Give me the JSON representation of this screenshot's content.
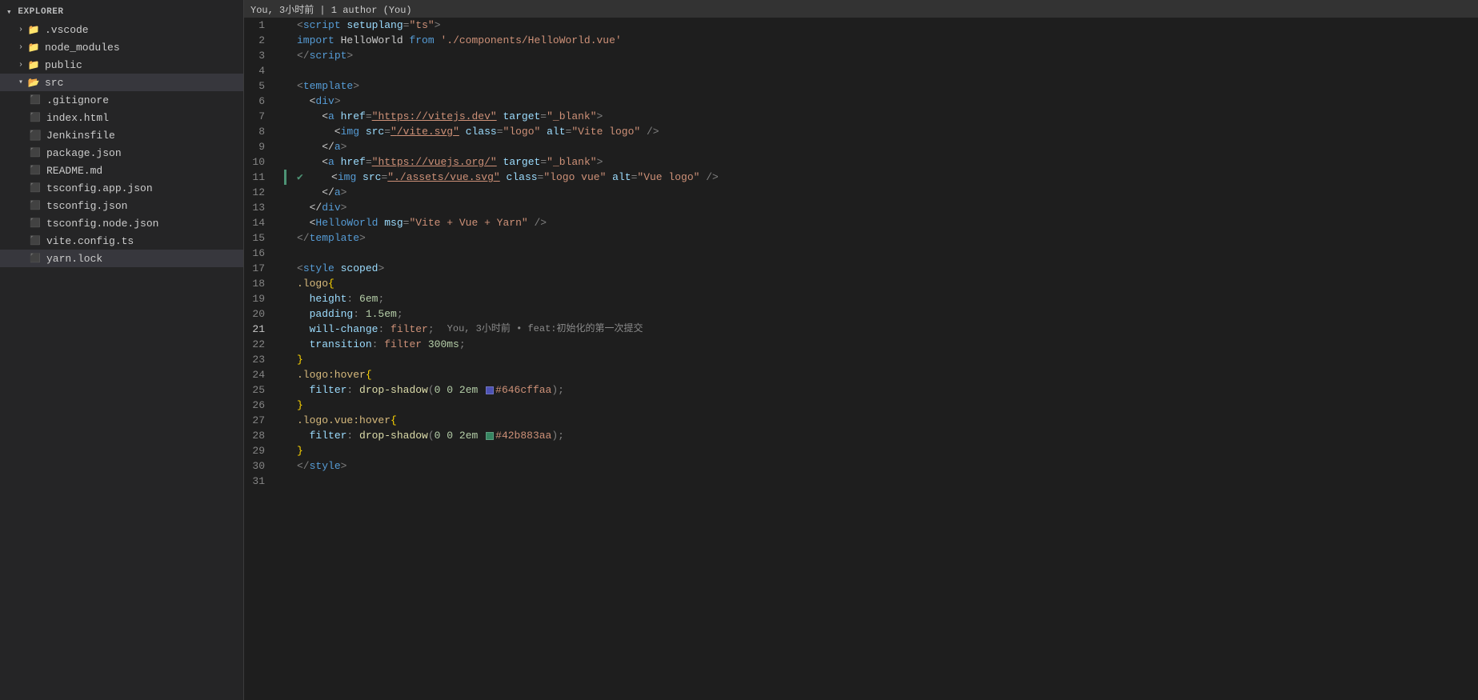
{
  "sidebar": {
    "items": [
      {
        "id": "vscode-folder",
        "label": ".vscode",
        "type": "folder",
        "indent": 1,
        "expanded": false,
        "icon": "folder"
      },
      {
        "id": "node-modules",
        "label": "node_modules",
        "type": "folder",
        "indent": 1,
        "expanded": false,
        "icon": "folder-node"
      },
      {
        "id": "public",
        "label": "public",
        "type": "folder",
        "indent": 1,
        "expanded": false,
        "icon": "folder"
      },
      {
        "id": "src",
        "label": "src",
        "type": "folder",
        "indent": 1,
        "expanded": true,
        "icon": "folder-src"
      },
      {
        "id": "gitignore",
        "label": ".gitignore",
        "type": "file",
        "indent": 2,
        "icon": "git"
      },
      {
        "id": "index-html",
        "label": "index.html",
        "type": "file",
        "indent": 2,
        "icon": "html"
      },
      {
        "id": "jenkinsfile",
        "label": "Jenkinsfile",
        "type": "file",
        "indent": 2,
        "icon": "jenkins"
      },
      {
        "id": "package-json",
        "label": "package.json",
        "type": "file",
        "indent": 2,
        "icon": "json"
      },
      {
        "id": "readme",
        "label": "README.md",
        "type": "file",
        "indent": 2,
        "icon": "md"
      },
      {
        "id": "tsconfig-app",
        "label": "tsconfig.app.json",
        "type": "file",
        "indent": 2,
        "icon": "ts"
      },
      {
        "id": "tsconfig-json",
        "label": "tsconfig.json",
        "type": "file",
        "indent": 2,
        "icon": "json"
      },
      {
        "id": "tsconfig-node",
        "label": "tsconfig.node.json",
        "type": "file",
        "indent": 2,
        "icon": "json"
      },
      {
        "id": "vite-config",
        "label": "vite.config.ts",
        "type": "file",
        "indent": 2,
        "icon": "vue"
      },
      {
        "id": "yarn-lock",
        "label": "yarn.lock",
        "type": "file",
        "indent": 2,
        "icon": "lock",
        "active": true
      }
    ]
  },
  "editor": {
    "topbar": {
      "text": "You, 3小时前  |  1 author (You)"
    },
    "lines": [
      {
        "num": 1,
        "content": "script_setup_lang_ts",
        "type": "script-tag"
      },
      {
        "num": 2,
        "content": "import_hellworld",
        "type": "import"
      },
      {
        "num": 3,
        "content": "script_close",
        "type": "script-close"
      },
      {
        "num": 4,
        "content": "",
        "type": "empty"
      },
      {
        "num": 5,
        "content": "template_open",
        "type": "template"
      },
      {
        "num": 6,
        "content": "div_open",
        "type": "tag"
      },
      {
        "num": 7,
        "content": "a_href_vitejs",
        "type": "tag"
      },
      {
        "num": 8,
        "content": "img_vite",
        "type": "tag"
      },
      {
        "num": 9,
        "content": "a_close",
        "type": "tag"
      },
      {
        "num": 10,
        "content": "a_href_vuejs",
        "type": "tag"
      },
      {
        "num": 11,
        "content": "img_vue",
        "type": "tag",
        "git_indicator": true
      },
      {
        "num": 12,
        "content": "a_close2",
        "type": "tag"
      },
      {
        "num": 13,
        "content": "div_close",
        "type": "tag"
      },
      {
        "num": 14,
        "content": "helloworld_component",
        "type": "tag"
      },
      {
        "num": 15,
        "content": "template_close",
        "type": "template"
      },
      {
        "num": 16,
        "content": "",
        "type": "empty"
      },
      {
        "num": 17,
        "content": "style_scoped",
        "type": "style"
      },
      {
        "num": 18,
        "content": "logo_selector",
        "type": "css"
      },
      {
        "num": 19,
        "content": "height_6em",
        "type": "css"
      },
      {
        "num": 20,
        "content": "padding_1_5em",
        "type": "css"
      },
      {
        "num": 21,
        "content": "will_change_filter",
        "type": "css",
        "blame": "You, 3小时前 • feat:初始化的第一次提交"
      },
      {
        "num": 22,
        "content": "transition_filter_300ms",
        "type": "css"
      },
      {
        "num": 23,
        "content": "brace_close",
        "type": "css"
      },
      {
        "num": 24,
        "content": "logo_hover",
        "type": "css"
      },
      {
        "num": 25,
        "content": "filter_drop_shadow_646",
        "type": "css"
      },
      {
        "num": 26,
        "content": "brace_close2",
        "type": "css"
      },
      {
        "num": 27,
        "content": "logo_vue_hover",
        "type": "css"
      },
      {
        "num": 28,
        "content": "filter_drop_shadow_42b",
        "type": "css"
      },
      {
        "num": 29,
        "content": "brace_close3",
        "type": "css"
      },
      {
        "num": 30,
        "content": "style_close",
        "type": "style"
      },
      {
        "num": 31,
        "content": "",
        "type": "empty"
      }
    ],
    "colors": {
      "color646": "#646cffaa",
      "color42b": "#42b883aa"
    }
  }
}
